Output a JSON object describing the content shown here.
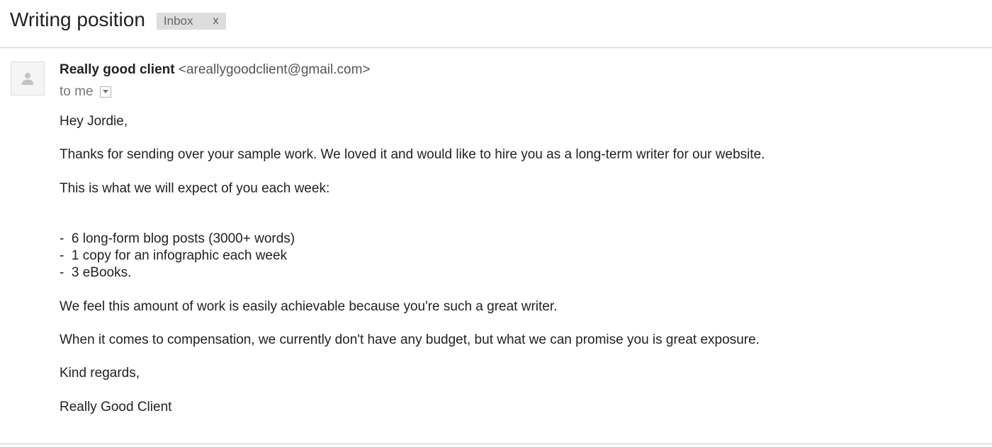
{
  "subject": "Writing position",
  "label_chip": {
    "label": "Inbox",
    "remove": "x"
  },
  "sender": {
    "name": "Really good client",
    "email": "<areallygoodclient@gmail.com>"
  },
  "recipient_line": "to me",
  "icons": {
    "avatar": "person-silhouette-icon",
    "details_toggle": "chevron-down-icon"
  },
  "body": {
    "greeting": "Hey Jordie,",
    "paragraph1": "Thanks for sending over your sample work. We loved it and would like to hire you as a long-term writer for our website.",
    "paragraph2": "This is what we will expect of you each week:",
    "list": [
      "-  6 long-form blog posts (3000+ words)",
      "-  1 copy for an infographic each week",
      "-  3 eBooks."
    ],
    "paragraph3": "We feel this amount of work is easily achievable because you're such a great writer.",
    "paragraph4": "When it comes to compensation, we currently don't have any budget, but what we can promise you is great exposure.",
    "closing": "Kind regards,",
    "signature": "Really Good Client"
  },
  "colors": {
    "text": "#222222",
    "muted": "#777777",
    "chip_bg": "#dddddd",
    "divider": "#c8c8c8"
  }
}
